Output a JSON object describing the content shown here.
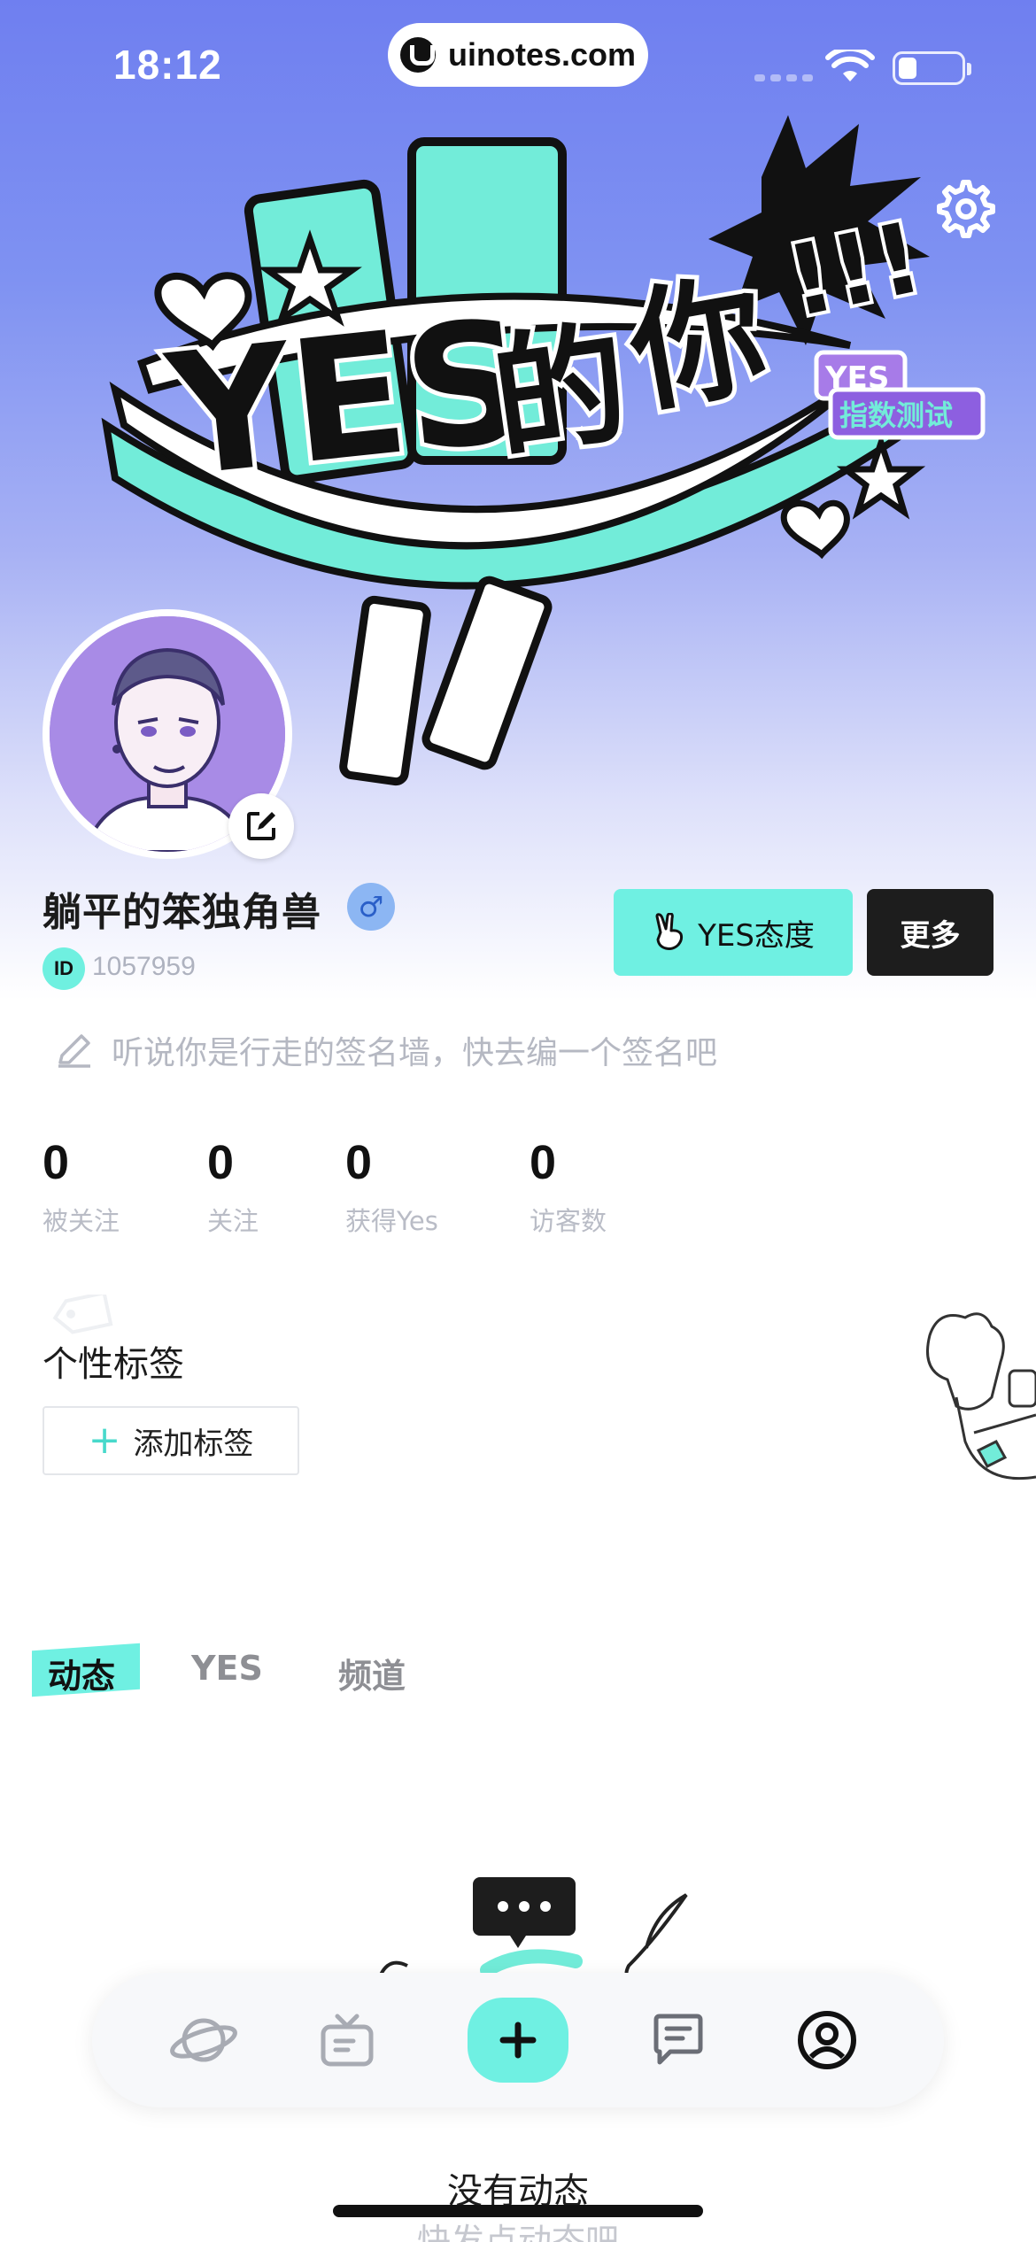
{
  "status_bar": {
    "time": "18:12",
    "url": "uinotes.com"
  },
  "profile": {
    "username": "躺平的笨独角兽",
    "gender_symbol": "♂",
    "id_label": "ID",
    "id_value": "1057959",
    "signature_placeholder": "听说你是行走的签名墙，快去编一个签名吧"
  },
  "banner": {
    "badge_top": "YES",
    "badge_bottom": "指数测试"
  },
  "actions": {
    "yes_attitude": "YES态度",
    "more": "更多"
  },
  "stats": [
    {
      "value": "0",
      "label": "被关注"
    },
    {
      "value": "0",
      "label": "关注"
    },
    {
      "value": "0",
      "label": "获得Yes"
    },
    {
      "value": "0",
      "label": "访客数"
    }
  ],
  "tags": {
    "title": "个性标签",
    "add_label": "添加标签"
  },
  "tabs": [
    {
      "label": "动态",
      "active": true
    },
    {
      "label": "YES",
      "active": false
    },
    {
      "label": "频道",
      "active": false
    }
  ],
  "empty_state": {
    "title": "没有动态",
    "subtitle": "快发点动态吧"
  },
  "bottom_nav": {
    "items": [
      "planet-icon",
      "tv-icon",
      "plus-icon",
      "chat-icon",
      "profile-icon"
    ]
  },
  "colors": {
    "accent": "#6ff0e2",
    "hero_top": "#6f7ff0",
    "dark_button": "#1d1d1d"
  }
}
